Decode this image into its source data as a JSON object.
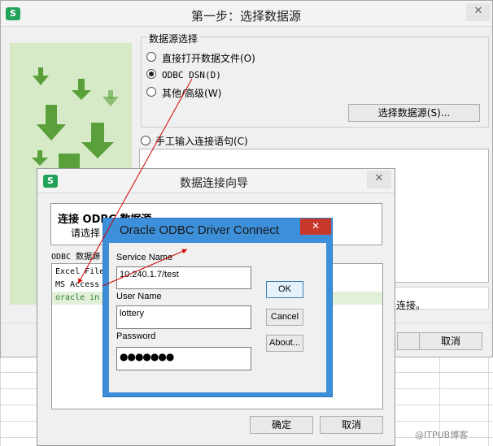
{
  "main_window": {
    "title": "第一步：选择数据源",
    "logo": "S",
    "close": "✕",
    "group_label": "数据源选择",
    "options": [
      {
        "label": "直接打开数据文件(O)",
        "selected": false
      },
      {
        "label": "ODBC DSN(D)",
        "selected": true
      },
      {
        "label": "其他/高级(W)",
        "selected": false
      }
    ],
    "choose_button": "选择数据源(S)...",
    "manual_option": "手工输入连接语句(C)",
    "connect_text_tail": "连接。",
    "cancel_button": "取消"
  },
  "wizard": {
    "title": "数据连接向导",
    "logo": "S",
    "close": "✕",
    "heading": "连接 ODBC 数据源",
    "subheading": "请选择",
    "list_label": "ODBC 数据源",
    "list_items": [
      "Excel Files",
      "MS Access",
      "oracle in"
    ],
    "ok_button": "确定",
    "cancel_button": "取消"
  },
  "oracle_dialog": {
    "title": "Oracle ODBC Driver Connect",
    "close": "✕",
    "service_label": "Service Name",
    "service_value": "10.240.1.7/test",
    "user_label": "User Name",
    "user_value": "lottery",
    "password_label": "Password",
    "password_value": "●●●●●●●",
    "ok": "OK",
    "cancel": "Cancel",
    "about": "About..."
  },
  "watermark": "@ITPUB博客",
  "colors": {
    "accent_blue": "#3c8fd8",
    "close_red": "#c7382b",
    "arrow_red": "#d40000",
    "green": "#5aa03a"
  }
}
